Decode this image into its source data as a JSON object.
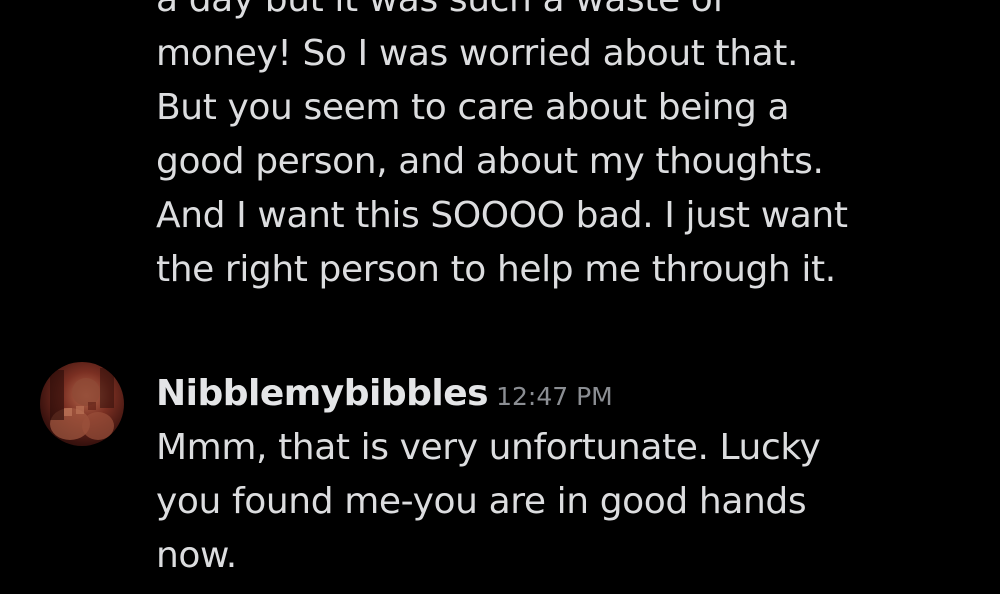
{
  "previous_message": {
    "lines": [
      "a day but it was such a waste of",
      "money! So I was worried about that.",
      "But you seem to care about being a",
      "good person, and about my thoughts.",
      "And I want this SOOOO bad. I just want",
      "the right person to help me through it."
    ]
  },
  "latest_message": {
    "avatar_icon": "profile-photo-avatar",
    "username": "Nibblemybibbles",
    "timestamp": "12:47 PM",
    "lines": [
      "Mmm, that is very unfortunate. Lucky",
      "you found me-you are in good hands",
      "now."
    ]
  },
  "colors": {
    "background": "#000000",
    "text": "#dcdddf",
    "timestamp": "#8b8e93"
  }
}
